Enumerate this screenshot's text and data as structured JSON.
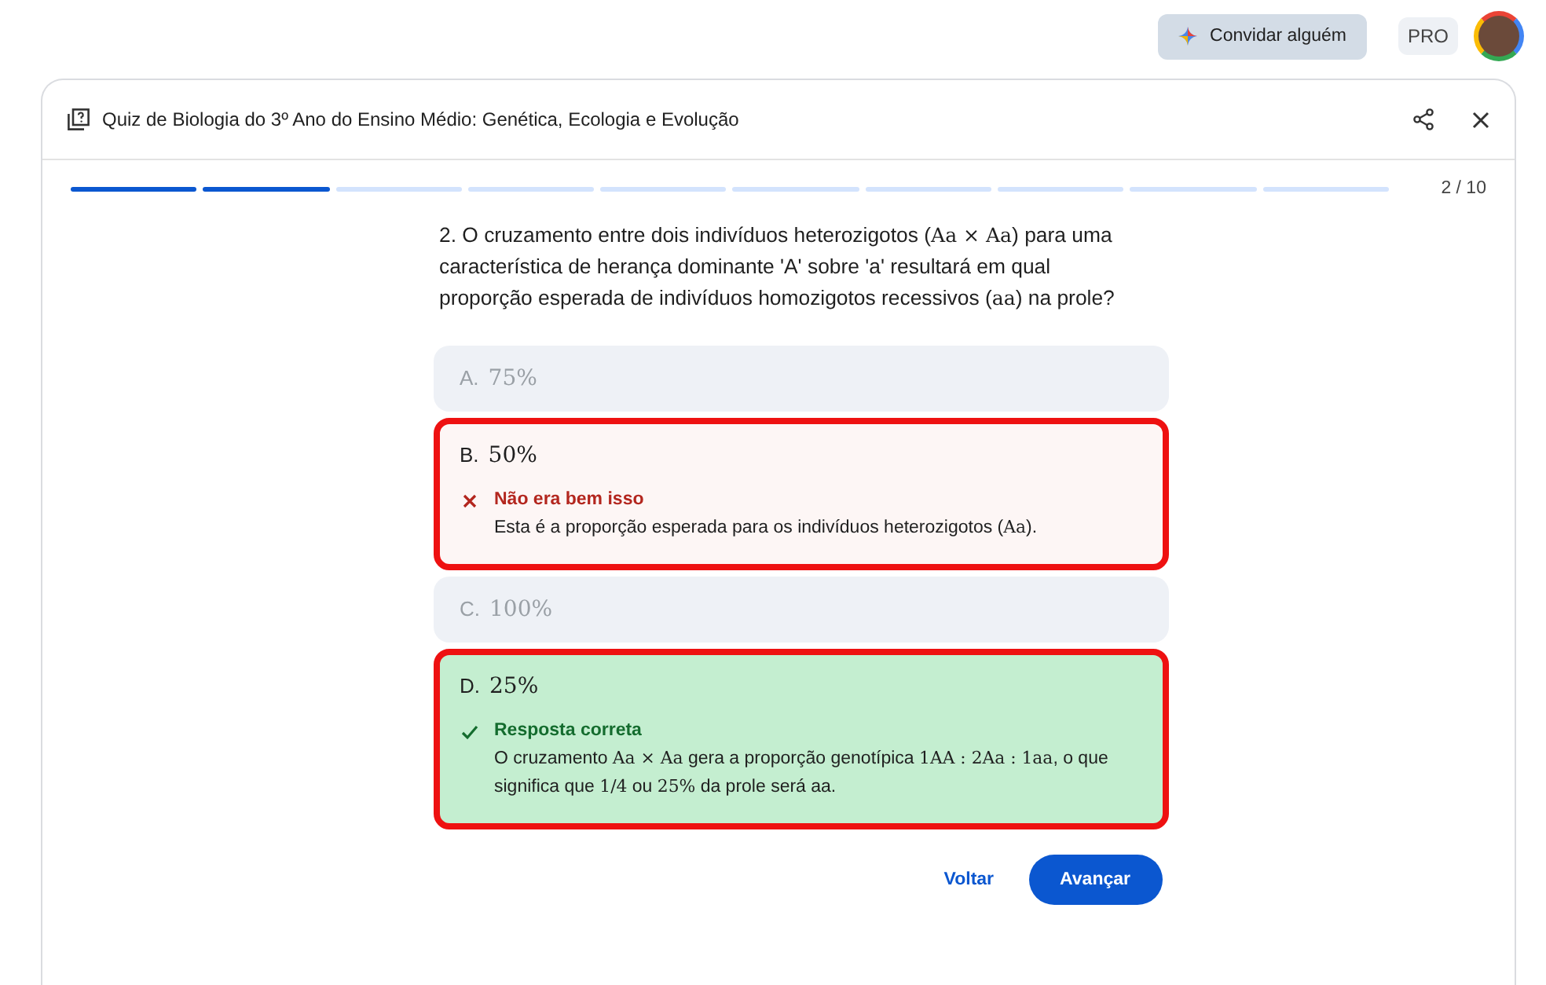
{
  "top_bar": {
    "invite_button": "Convidar alguém",
    "plan_badge": "PRO"
  },
  "quiz": {
    "title": "Quiz de Biologia do 3º Ano do Ensino Médio: Genética, Ecologia e Evolução",
    "progress": [
      {
        "done": true
      },
      {
        "done": true
      },
      {
        "done": false
      },
      {
        "done": false
      },
      {
        "done": false
      },
      {
        "done": false
      },
      {
        "done": false
      },
      {
        "done": false
      },
      {
        "done": false
      },
      {
        "done": false
      }
    ],
    "counter": "2 / 10",
    "question": [
      {
        "kind": "text",
        "text": "2. O cruzamento entre dois indivíduos heterozigotos ("
      },
      {
        "kind": "math",
        "text": "Aa × Aa"
      },
      {
        "kind": "text",
        "text": ") para uma característica de herança dominante 'A' sobre 'a' resultará em qual proporção esperada de indivíduos homozigotos recessivos ("
      },
      {
        "kind": "math",
        "text": "aa"
      },
      {
        "kind": "text",
        "text": ") na prole?"
      }
    ],
    "options": [
      {
        "letter": "A.",
        "value": "75%",
        "kind": "dimmed",
        "highlighted": false
      },
      {
        "letter": "B.",
        "value": "50%",
        "kind": "wrong",
        "highlighted": true,
        "feedback": {
          "title": "Não era bem isso",
          "body": [
            {
              "kind": "text",
              "text": "Esta é a proporção esperada para os indivíduos heterozigotos ("
            },
            {
              "kind": "math",
              "text": "Aa"
            },
            {
              "kind": "text",
              "text": ")."
            }
          ]
        }
      },
      {
        "letter": "C.",
        "value": "100%",
        "kind": "dimmed",
        "highlighted": false
      },
      {
        "letter": "D.",
        "value": "25%",
        "kind": "correct",
        "highlighted": true,
        "feedback": {
          "title": "Resposta correta",
          "body": [
            {
              "kind": "text",
              "text": "O cruzamento "
            },
            {
              "kind": "math",
              "text": "Aa × Aa"
            },
            {
              "kind": "text",
              "text": " gera a proporção genotípica "
            },
            {
              "kind": "math",
              "text": "1AA : 2Aa : 1aa"
            },
            {
              "kind": "text",
              "text": ", o que significa que "
            },
            {
              "kind": "math",
              "text": "1/4"
            },
            {
              "kind": "text",
              "text": " ou "
            },
            {
              "kind": "math",
              "text": "25%"
            },
            {
              "kind": "text",
              "text": " da prole será aa."
            }
          ]
        }
      }
    ],
    "back_button": "Voltar",
    "next_button": "Avançar"
  }
}
